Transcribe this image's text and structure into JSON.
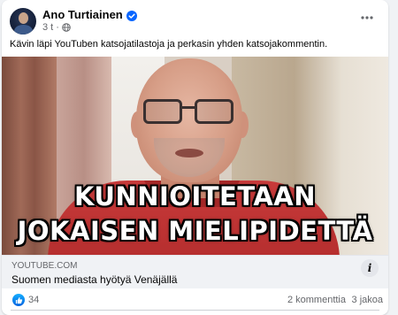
{
  "post": {
    "author": "Ano Turtiainen",
    "timestamp": "3 t",
    "privacy_icon": "globe-icon",
    "text": "Kävin läpi YouTuben katsojatilastoja ja perkasin yhden katsojakommentin.",
    "more_icon": "more-options-icon"
  },
  "video": {
    "caption_line1": "KUNNIOITETAAN",
    "caption_line2": "JOKAISEN MIELIPIDETTÄ"
  },
  "link": {
    "domain": "YOUTUBE.COM",
    "title": "Suomen mediasta hyötyä Venäjällä",
    "info_label": "i"
  },
  "stats": {
    "likes": "34",
    "comments": "2 kommenttia",
    "shares": "3 jakoa"
  },
  "colors": {
    "accent": "#0866ff",
    "like_gradient_top": "#18afff",
    "like_gradient_bottom": "#0062df",
    "secondary_text": "#65676b"
  }
}
